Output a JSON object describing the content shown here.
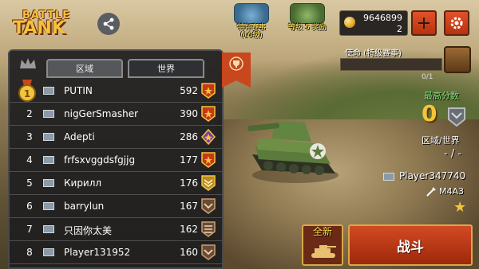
{
  "logo": {
    "line1": "BATTLE",
    "line2": "TANK"
  },
  "promos": [
    {
      "text_line1": "特许赛事",
      "text_line2": "(10级)"
    },
    {
      "text_line1": "等级 5 奖励",
      "text_line2": ""
    }
  ],
  "currency": {
    "coins": "9646899",
    "gems": "2"
  },
  "leaderboard": {
    "tabs": [
      {
        "label": "区域",
        "active": true
      },
      {
        "label": "世界",
        "active": false
      }
    ],
    "rows": [
      {
        "rank": "1",
        "name": "PUTIN",
        "score": "592"
      },
      {
        "rank": "2",
        "name": "nigGerSmasher",
        "score": "390"
      },
      {
        "rank": "3",
        "name": "Adepti",
        "score": "286"
      },
      {
        "rank": "4",
        "name": "frfsxvggdsfgjjg",
        "score": "177"
      },
      {
        "rank": "5",
        "name": "Кирилл",
        "score": "176"
      },
      {
        "rank": "6",
        "name": "barrylun",
        "score": "167"
      },
      {
        "rank": "7",
        "name": "只因你太美",
        "score": "162"
      },
      {
        "rank": "8",
        "name": "Player131952",
        "score": "160"
      }
    ]
  },
  "mission": {
    "label": "使命 (特级赛事)",
    "progress": "0/1"
  },
  "stats": {
    "best_label": "最高分数",
    "best_value": "0",
    "region_world_label": "区域/世界",
    "region_world_value": "- / -",
    "player_name": "Player347740",
    "tank_name": "M4A3"
  },
  "buttons": {
    "new_label": "全新",
    "fight_label": "战斗"
  },
  "colors": {
    "accent": "#c8471c",
    "gold": "#f2c53a",
    "green_label": "#7fe07a"
  }
}
